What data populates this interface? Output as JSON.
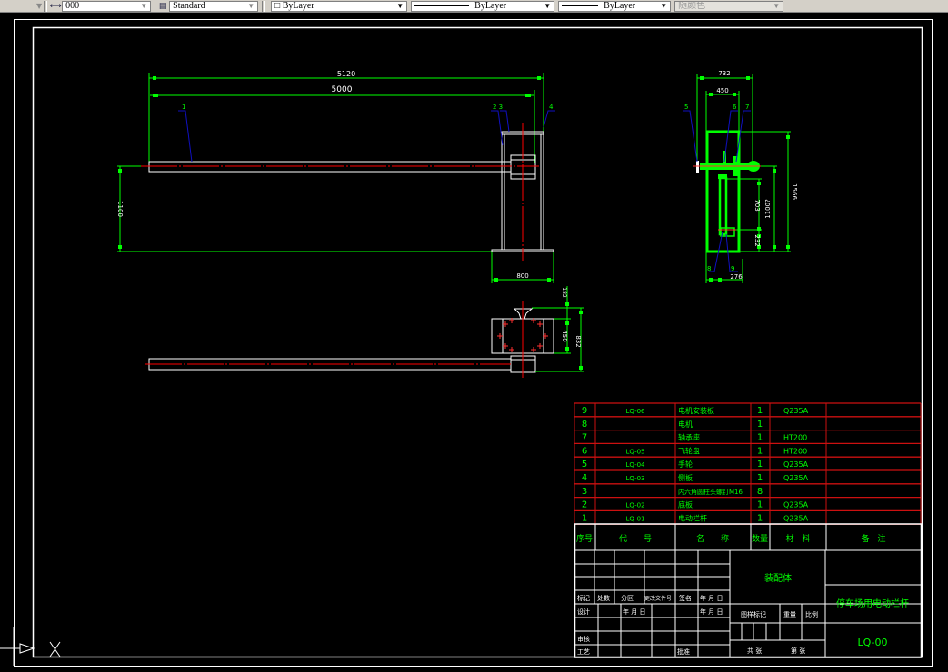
{
  "toolbar": {
    "dimstyle_value": "000",
    "textstyle_value": "Standard",
    "color_value": "ByLayer",
    "linetype_value": "ByLayer",
    "lineweight_value": "ByLayer",
    "plotstyle_value": "随颜色"
  },
  "colors": {
    "background": "#000000",
    "lines": "#ffffff",
    "dims": "#00ff00",
    "center": "#ff0000",
    "leaders": "#0000cc",
    "table_rows": "#cc0000"
  },
  "drawing": {
    "front_view": {
      "dim_overall": "5120",
      "dim_bar": "5000",
      "dim_height": "1100",
      "dim_base": "800",
      "labels": [
        "1",
        "2 3",
        "4"
      ]
    },
    "side_view": {
      "dim_width": "732",
      "dim_frame": "450",
      "dim_total_height": "1566",
      "dim_axis_height": "1100?",
      "dim_upper": "703",
      "dim_lower": "232",
      "dim_bottom": "276",
      "labels": [
        "5",
        "6",
        "7",
        "8",
        "9"
      ]
    },
    "top_view": {
      "dim_top": "182",
      "dim_box": "450",
      "dim_total": "832"
    }
  },
  "parts_list": {
    "rows": [
      {
        "no": "9",
        "code": "LQ-06",
        "name": "电机安装板",
        "qty": "1",
        "material": "Q235A"
      },
      {
        "no": "8",
        "code": "",
        "name": "电机",
        "qty": "1",
        "material": ""
      },
      {
        "no": "7",
        "code": "",
        "name": "轴承座",
        "qty": "1",
        "material": "HT200"
      },
      {
        "no": "6",
        "code": "LQ-05",
        "name": "飞轮盘",
        "qty": "1",
        "material": "HT200"
      },
      {
        "no": "5",
        "code": "LQ-04",
        "name": "手轮",
        "qty": "1",
        "material": "Q235A"
      },
      {
        "no": "4",
        "code": "LQ-03",
        "name": "侧板",
        "qty": "1",
        "material": "Q235A"
      },
      {
        "no": "3",
        "code": "",
        "name": "内六角圆柱头螺钉M16",
        "qty": "8",
        "material": ""
      },
      {
        "no": "2",
        "code": "LQ-02",
        "name": "底板",
        "qty": "1",
        "material": "Q235A"
      },
      {
        "no": "1",
        "code": "LQ-01",
        "name": "电动栏杆",
        "qty": "1",
        "material": "Q235A"
      }
    ],
    "header": {
      "no": "序号",
      "code": "代　　号",
      "name": "名　　称",
      "qty": "数量",
      "material": "材　料",
      "remark": "备　注"
    }
  },
  "title_block": {
    "assembly": "装配体",
    "title": "停车场用电动栏杆",
    "drawing_no": "LQ-00",
    "mark": "标记",
    "count": "处数",
    "zone": "分区",
    "change_doc": "更改文件号",
    "signature": "签名",
    "date": "年 月 日",
    "design": "设计",
    "date2": "年 月 日",
    "date3": "年 月 日",
    "review": "审核",
    "process": "工艺",
    "approve": "批准",
    "stage_mark": "图样标记",
    "weight": "重量",
    "scale": "比例",
    "sheets": "共 张",
    "sheet_no": "第 张"
  }
}
